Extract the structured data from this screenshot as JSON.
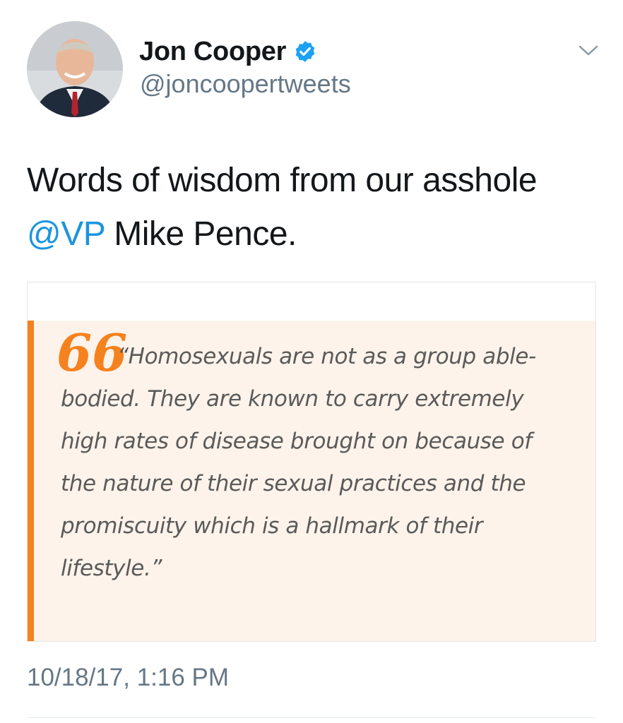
{
  "user": {
    "display_name": "Jon Cooper",
    "handle": "@joncoopertweets",
    "verified": true
  },
  "icons": {
    "verified": "verified-badge-icon",
    "caret": "chevron-down-icon",
    "quote": "quote-mark-icon"
  },
  "tweet": {
    "text_part1": "Words of wisdom from our asshole ",
    "mention": "@VP",
    "text_part2": " Mike Pence."
  },
  "media": {
    "quote_glyph": "66",
    "quote_text": "“Homosexuals are not as a group able-bodied. They are known to carry extremely high rates of disease brought on because of the nature of their sexual practices and the promiscuity which is a hallmark of their lifestyle.”"
  },
  "timestamp": "10/18/17, 1:16 PM",
  "colors": {
    "mention": "#1b95e0",
    "verified": "#1da1f2",
    "quote_accent": "#f5821f",
    "quote_background": "#fdf3ea",
    "secondary_text": "#657786"
  }
}
